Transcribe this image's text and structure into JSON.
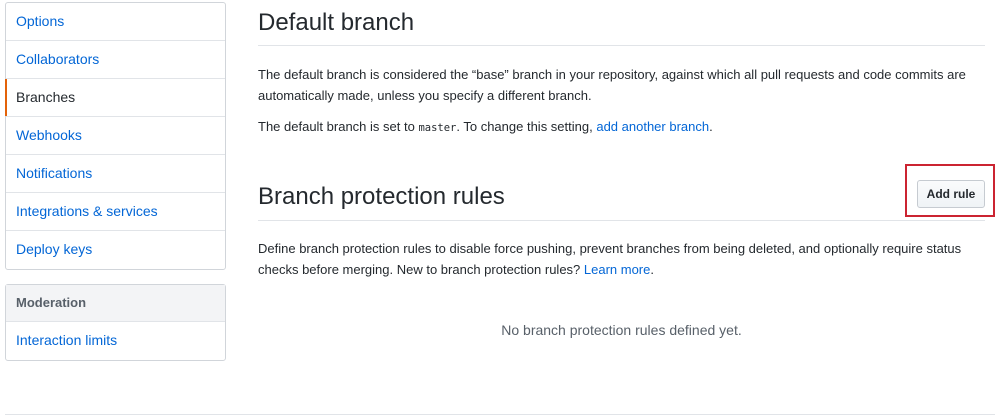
{
  "sidebar": {
    "items": [
      {
        "label": "Options"
      },
      {
        "label": "Collaborators"
      },
      {
        "label": "Branches",
        "selected": true
      },
      {
        "label": "Webhooks"
      },
      {
        "label": "Notifications"
      },
      {
        "label": "Integrations & services"
      },
      {
        "label": "Deploy keys"
      }
    ],
    "moderation_heading": "Moderation",
    "moderation_items": [
      {
        "label": "Interaction limits"
      }
    ]
  },
  "default_branch": {
    "title": "Default branch",
    "description": "The default branch is considered the “base” branch in your repository, against which all pull requests and code commits are automatically made, unless you specify a different branch.",
    "set_prefix": "The default branch is set to ",
    "branch_name": "master",
    "set_middle": ". To change this setting, ",
    "link_text": "add another branch",
    "set_suffix": "."
  },
  "protection": {
    "title": "Branch protection rules",
    "add_rule_label": "Add rule",
    "description": "Define branch protection rules to disable force pushing, prevent branches from being deleted, and optionally require status checks before merging. New to branch protection rules? ",
    "learn_more": "Learn more",
    "learn_more_suffix": ".",
    "empty_state": "No branch protection rules defined yet."
  },
  "colors": {
    "link": "#0366d6",
    "selected_indicator": "#e36209",
    "highlight_box": "#cb2431"
  }
}
